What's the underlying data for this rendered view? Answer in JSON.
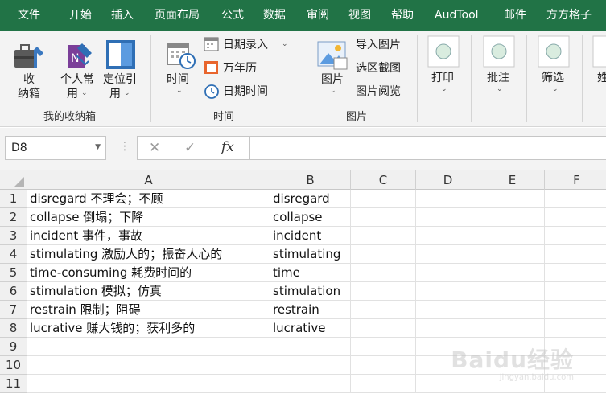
{
  "tabs": [
    "文件",
    "开始",
    "插入",
    "页面布局",
    "公式",
    "数据",
    "审阅",
    "视图",
    "帮助",
    "AudTool",
    "邮件",
    "方方格子"
  ],
  "ribbon": {
    "collect": {
      "label_line1": "收",
      "label_line2": "纳箱"
    },
    "personal": {
      "label_line1": "个人常",
      "label_line2": "用"
    },
    "locate": {
      "label_line1": "定位引",
      "label_line2": "用"
    },
    "group_collect": "我的收纳箱",
    "time_btn": "时间",
    "date_entry": "日期录入",
    "calendar": "万年历",
    "datetime": "日期时间",
    "group_time": "时间",
    "picture_btn": "图片",
    "import_picture": "导入图片",
    "area_screenshot": "选区截图",
    "picture_browse": "图片阅览",
    "group_picture": "图片",
    "print_btn": "打印",
    "annotate_btn": "批注",
    "filter_btn": "筛选",
    "more_btn": "姓"
  },
  "formula_bar": {
    "name_box": "D8",
    "cancel_icon": "✕",
    "enter_icon": "✓",
    "fx_label": "fx",
    "formula": ""
  },
  "columns": [
    "A",
    "B",
    "C",
    "D",
    "E",
    "F"
  ],
  "rows": [
    {
      "num": "1",
      "a": "disregard 不理会；不顾",
      "b": "disregard"
    },
    {
      "num": "2",
      "a": "collapse 倒塌；下降",
      "b": "collapse"
    },
    {
      "num": "3",
      "a": "incident 事件，事故",
      "b": "incident"
    },
    {
      "num": "4",
      "a": "stimulating 激励人的；振奋人心的",
      "b": "stimulating"
    },
    {
      "num": "5",
      "a": "time-consuming 耗费时间的",
      "b": "time"
    },
    {
      "num": "6",
      "a": "stimulation 模拟；仿真",
      "b": "stimulation"
    },
    {
      "num": "7",
      "a": "restrain 限制；阻碍",
      "b": "restrain"
    },
    {
      "num": "8",
      "a": "lucrative 赚大钱的；获利多的",
      "b": "lucrative"
    },
    {
      "num": "9",
      "a": "",
      "b": ""
    },
    {
      "num": "10",
      "a": "",
      "b": ""
    },
    {
      "num": "11",
      "a": "",
      "b": ""
    }
  ],
  "watermark": {
    "text": "Baidu经验",
    "sub": "jingyan.baidu.com"
  },
  "colors": {
    "ribbon_green": "#217346",
    "ribbon_bg": "#f3f3f3",
    "header_bg": "#f0f0f0"
  }
}
